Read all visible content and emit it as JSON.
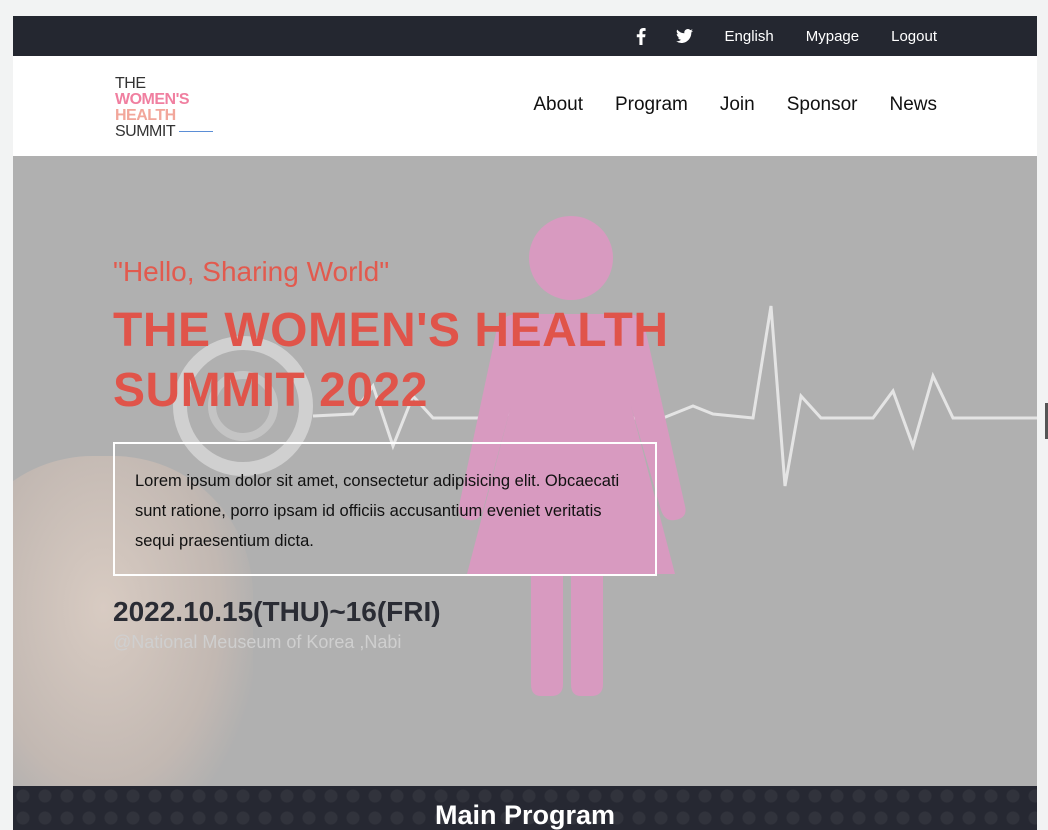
{
  "topbar": {
    "icons": [
      "facebook-icon",
      "twitter-icon"
    ],
    "links": [
      "English",
      "Mypage",
      "Logout"
    ]
  },
  "logo": {
    "line1": "THE",
    "line2": "WOMEN'S",
    "line3": "HEALTH",
    "line4": "SUMMIT"
  },
  "nav": {
    "items": [
      "About",
      "Program",
      "Join",
      "Sponsor",
      "News"
    ]
  },
  "hero": {
    "tagline": "\"Hello, Sharing World\"",
    "title": "THE WOMEN'S HEALTH SUMMIT 2022",
    "description": "Lorem ipsum dolor sit amet, consectetur adipisicing elit. Obcaecati sunt ratione, porro ipsam id officiis accusantium eveniet veritatis sequi praesentium dicta.",
    "date": "2022.10.15(THU)~16(FRI)",
    "venue": "@National Meuseum of Korea ,Nabi"
  },
  "program": {
    "heading": "Main Program"
  },
  "colors": {
    "topbar_bg": "#242730",
    "accent": "#e0544a",
    "hero_bg": "#b0b0b0",
    "figure": "#d89ac0"
  }
}
